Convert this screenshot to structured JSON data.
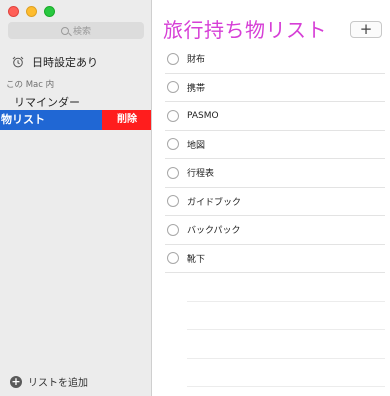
{
  "sidebar": {
    "search_placeholder": "検索",
    "scheduled_label": "日時設定あり",
    "section_label": "この Mac 内",
    "reminders_label": "リマインダー",
    "selected_list_label": "物リスト",
    "delete_label": "削除",
    "add_list_label": "リストを追加"
  },
  "main": {
    "title": "旅行持ち物リスト",
    "add_button": "+",
    "items": [
      {
        "text": "財布"
      },
      {
        "text": "携帯"
      },
      {
        "text": "PASMO"
      },
      {
        "text": "地図"
      },
      {
        "text": "行程表"
      },
      {
        "text": "ガイドブック"
      },
      {
        "text": "バックパック"
      },
      {
        "text": "靴下"
      }
    ]
  },
  "colors": {
    "title": "#d63fd6",
    "selection": "#2067d4",
    "delete": "#ff1d1d"
  },
  "icons": [
    "alarm-clock-icon",
    "search-icon",
    "add-circle-icon"
  ]
}
